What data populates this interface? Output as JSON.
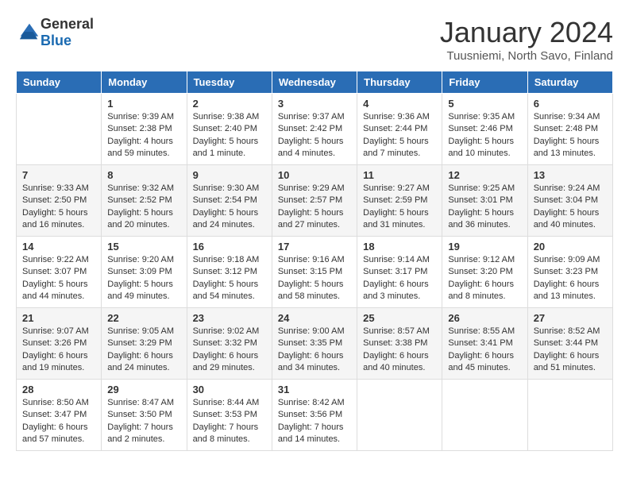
{
  "logo": {
    "general": "General",
    "blue": "Blue"
  },
  "header": {
    "month": "January 2024",
    "location": "Tuusniemi, North Savo, Finland"
  },
  "weekdays": [
    "Sunday",
    "Monday",
    "Tuesday",
    "Wednesday",
    "Thursday",
    "Friday",
    "Saturday"
  ],
  "weeks": [
    [
      {
        "day": "",
        "info": ""
      },
      {
        "day": "1",
        "info": "Sunrise: 9:39 AM\nSunset: 2:38 PM\nDaylight: 4 hours\nand 59 minutes."
      },
      {
        "day": "2",
        "info": "Sunrise: 9:38 AM\nSunset: 2:40 PM\nDaylight: 5 hours\nand 1 minute."
      },
      {
        "day": "3",
        "info": "Sunrise: 9:37 AM\nSunset: 2:42 PM\nDaylight: 5 hours\nand 4 minutes."
      },
      {
        "day": "4",
        "info": "Sunrise: 9:36 AM\nSunset: 2:44 PM\nDaylight: 5 hours\nand 7 minutes."
      },
      {
        "day": "5",
        "info": "Sunrise: 9:35 AM\nSunset: 2:46 PM\nDaylight: 5 hours\nand 10 minutes."
      },
      {
        "day": "6",
        "info": "Sunrise: 9:34 AM\nSunset: 2:48 PM\nDaylight: 5 hours\nand 13 minutes."
      }
    ],
    [
      {
        "day": "7",
        "info": "Sunrise: 9:33 AM\nSunset: 2:50 PM\nDaylight: 5 hours\nand 16 minutes."
      },
      {
        "day": "8",
        "info": "Sunrise: 9:32 AM\nSunset: 2:52 PM\nDaylight: 5 hours\nand 20 minutes."
      },
      {
        "day": "9",
        "info": "Sunrise: 9:30 AM\nSunset: 2:54 PM\nDaylight: 5 hours\nand 24 minutes."
      },
      {
        "day": "10",
        "info": "Sunrise: 9:29 AM\nSunset: 2:57 PM\nDaylight: 5 hours\nand 27 minutes."
      },
      {
        "day": "11",
        "info": "Sunrise: 9:27 AM\nSunset: 2:59 PM\nDaylight: 5 hours\nand 31 minutes."
      },
      {
        "day": "12",
        "info": "Sunrise: 9:25 AM\nSunset: 3:01 PM\nDaylight: 5 hours\nand 36 minutes."
      },
      {
        "day": "13",
        "info": "Sunrise: 9:24 AM\nSunset: 3:04 PM\nDaylight: 5 hours\nand 40 minutes."
      }
    ],
    [
      {
        "day": "14",
        "info": "Sunrise: 9:22 AM\nSunset: 3:07 PM\nDaylight: 5 hours\nand 44 minutes."
      },
      {
        "day": "15",
        "info": "Sunrise: 9:20 AM\nSunset: 3:09 PM\nDaylight: 5 hours\nand 49 minutes."
      },
      {
        "day": "16",
        "info": "Sunrise: 9:18 AM\nSunset: 3:12 PM\nDaylight: 5 hours\nand 54 minutes."
      },
      {
        "day": "17",
        "info": "Sunrise: 9:16 AM\nSunset: 3:15 PM\nDaylight: 5 hours\nand 58 minutes."
      },
      {
        "day": "18",
        "info": "Sunrise: 9:14 AM\nSunset: 3:17 PM\nDaylight: 6 hours\nand 3 minutes."
      },
      {
        "day": "19",
        "info": "Sunrise: 9:12 AM\nSunset: 3:20 PM\nDaylight: 6 hours\nand 8 minutes."
      },
      {
        "day": "20",
        "info": "Sunrise: 9:09 AM\nSunset: 3:23 PM\nDaylight: 6 hours\nand 13 minutes."
      }
    ],
    [
      {
        "day": "21",
        "info": "Sunrise: 9:07 AM\nSunset: 3:26 PM\nDaylight: 6 hours\nand 19 minutes."
      },
      {
        "day": "22",
        "info": "Sunrise: 9:05 AM\nSunset: 3:29 PM\nDaylight: 6 hours\nand 24 minutes."
      },
      {
        "day": "23",
        "info": "Sunrise: 9:02 AM\nSunset: 3:32 PM\nDaylight: 6 hours\nand 29 minutes."
      },
      {
        "day": "24",
        "info": "Sunrise: 9:00 AM\nSunset: 3:35 PM\nDaylight: 6 hours\nand 34 minutes."
      },
      {
        "day": "25",
        "info": "Sunrise: 8:57 AM\nSunset: 3:38 PM\nDaylight: 6 hours\nand 40 minutes."
      },
      {
        "day": "26",
        "info": "Sunrise: 8:55 AM\nSunset: 3:41 PM\nDaylight: 6 hours\nand 45 minutes."
      },
      {
        "day": "27",
        "info": "Sunrise: 8:52 AM\nSunset: 3:44 PM\nDaylight: 6 hours\nand 51 minutes."
      }
    ],
    [
      {
        "day": "28",
        "info": "Sunrise: 8:50 AM\nSunset: 3:47 PM\nDaylight: 6 hours\nand 57 minutes."
      },
      {
        "day": "29",
        "info": "Sunrise: 8:47 AM\nSunset: 3:50 PM\nDaylight: 7 hours\nand 2 minutes."
      },
      {
        "day": "30",
        "info": "Sunrise: 8:44 AM\nSunset: 3:53 PM\nDaylight: 7 hours\nand 8 minutes."
      },
      {
        "day": "31",
        "info": "Sunrise: 8:42 AM\nSunset: 3:56 PM\nDaylight: 7 hours\nand 14 minutes."
      },
      {
        "day": "",
        "info": ""
      },
      {
        "day": "",
        "info": ""
      },
      {
        "day": "",
        "info": ""
      }
    ]
  ]
}
